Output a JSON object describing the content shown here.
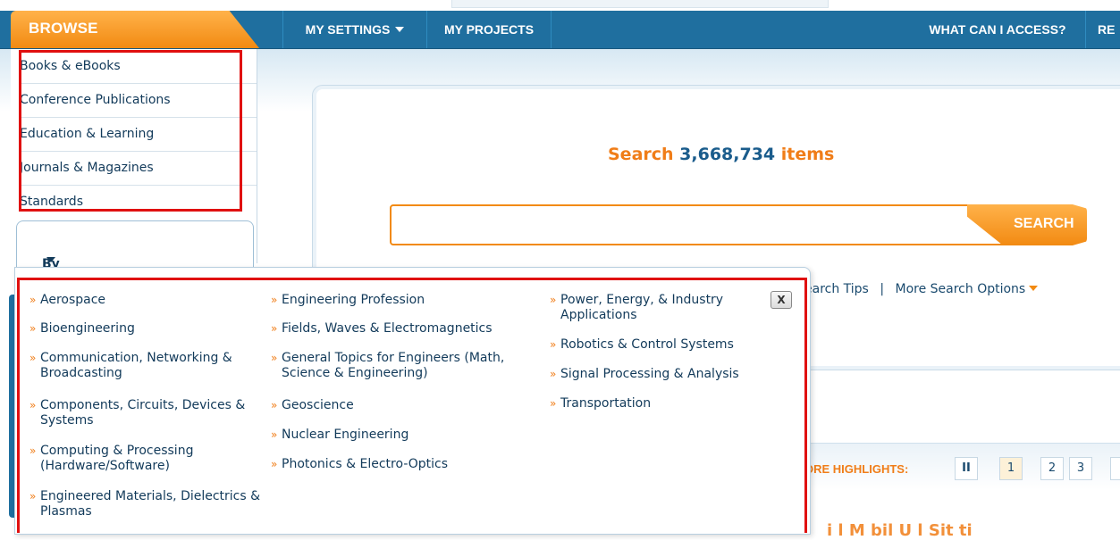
{
  "nav": {
    "browse": "BROWSE",
    "my_settings": "MY SETTINGS",
    "my_projects": "MY PROJECTS",
    "what_can_i_access": "WHAT CAN I ACCESS?",
    "cut_item": "RE"
  },
  "browse": {
    "items": [
      {
        "label": "Books & eBooks"
      },
      {
        "label": "Conference Publications"
      },
      {
        "label": "Education & Learning"
      },
      {
        "label": "Journals & Magazines"
      },
      {
        "label": "Standards"
      }
    ],
    "by_topic": "By Topic"
  },
  "search": {
    "heading_prefix": "Search ",
    "count": "3,668,734",
    "heading_suffix": " items",
    "input_value": "",
    "button_label": "SEARCH",
    "tips": "earch Tips",
    "separator": "|",
    "more_options": "More Search Options"
  },
  "topics": {
    "col1": [
      {
        "label": "Aerospace"
      },
      {
        "label": "Bioengineering"
      },
      {
        "label": "Communication, Networking & Broadcasting"
      },
      {
        "label": "Components, Circuits, Devices & Systems"
      },
      {
        "label": "Computing & Processing (Hardware/Software)"
      },
      {
        "label": "Engineered Materials, Dielectrics & Plasmas"
      }
    ],
    "col2": [
      {
        "label": "Engineering Profession"
      },
      {
        "label": "Fields, Waves & Electromagnetics"
      },
      {
        "label": "General Topics for Engineers (Math, Science & Engineering)"
      },
      {
        "label": "Geoscience"
      },
      {
        "label": "Nuclear Engineering"
      },
      {
        "label": "Photonics & Electro-Optics"
      }
    ],
    "col3": [
      {
        "label": "Power, Energy, & Industry Applications"
      },
      {
        "label": "Robotics & Control Systems"
      },
      {
        "label": "Signal Processing & Analysis"
      },
      {
        "label": "Transportation"
      }
    ],
    "bullet": "»",
    "close_label": "X"
  },
  "highlights": {
    "label": "ORE HIGHLIGHTS:",
    "pause": "II",
    "pages": [
      "1",
      "2",
      "3"
    ],
    "bottom_text": "i  l     M  bil  U  l     Sit  ti"
  },
  "colors": {
    "nav_blue": "#1f6f9f",
    "accent_orange": "#f28a12",
    "highlight_red": "#e01010"
  }
}
